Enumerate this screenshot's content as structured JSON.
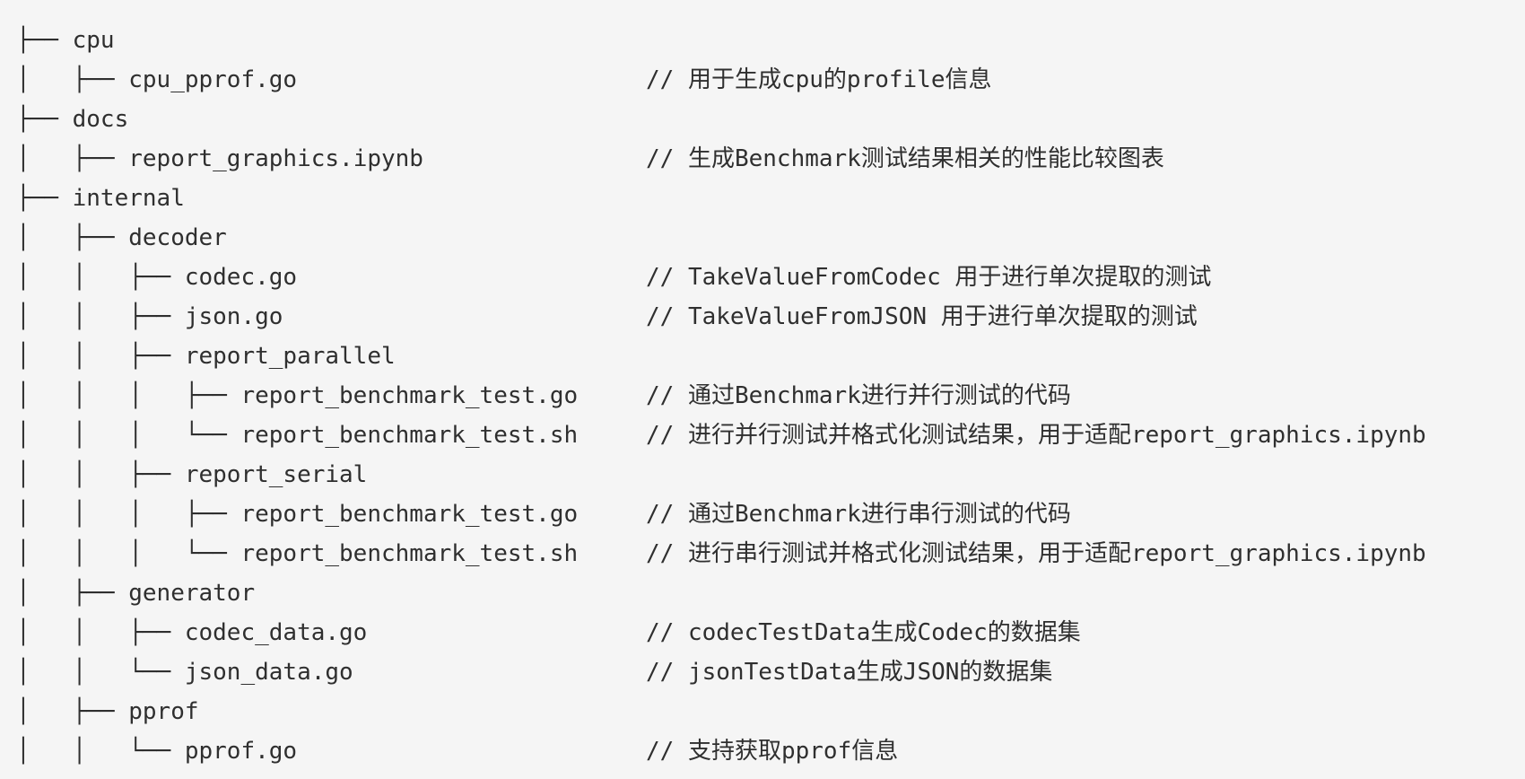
{
  "tree": {
    "lines": [
      {
        "prefix": "├── ",
        "name": "cpu",
        "comment": ""
      },
      {
        "prefix": "│   ├── ",
        "name": "cpu_pprof.go",
        "comment": "// 用于生成cpu的profile信息"
      },
      {
        "prefix": "├── ",
        "name": "docs",
        "comment": ""
      },
      {
        "prefix": "│   ├── ",
        "name": "report_graphics.ipynb",
        "comment": "// 生成Benchmark测试结果相关的性能比较图表"
      },
      {
        "prefix": "├── ",
        "name": "internal",
        "comment": ""
      },
      {
        "prefix": "│   ├── ",
        "name": "decoder",
        "comment": ""
      },
      {
        "prefix": "│   │   ├── ",
        "name": "codec.go",
        "comment": "// TakeValueFromCodec 用于进行单次提取的测试"
      },
      {
        "prefix": "│   │   ├── ",
        "name": "json.go",
        "comment": "// TakeValueFromJSON 用于进行单次提取的测试"
      },
      {
        "prefix": "│   │   ├── ",
        "name": "report_parallel",
        "comment": ""
      },
      {
        "prefix": "│   │   │   ├── ",
        "name": "report_benchmark_test.go",
        "comment": "// 通过Benchmark进行并行测试的代码"
      },
      {
        "prefix": "│   │   │   └── ",
        "name": "report_benchmark_test.sh",
        "comment": "// 进行并行测试并格式化测试结果，用于适配report_graphics.ipynb"
      },
      {
        "prefix": "│   │   ├── ",
        "name": "report_serial",
        "comment": ""
      },
      {
        "prefix": "│   │   │   ├── ",
        "name": "report_benchmark_test.go",
        "comment": "// 通过Benchmark进行串行测试的代码"
      },
      {
        "prefix": "│   │   │   └── ",
        "name": "report_benchmark_test.sh",
        "comment": "// 进行串行测试并格式化测试结果，用于适配report_graphics.ipynb"
      },
      {
        "prefix": "│   ├── ",
        "name": "generator",
        "comment": ""
      },
      {
        "prefix": "│   │   ├── ",
        "name": "codec_data.go",
        "comment": "// codecTestData生成Codec的数据集"
      },
      {
        "prefix": "│   │   └── ",
        "name": "json_data.go",
        "comment": "// jsonTestData生成JSON的数据集"
      },
      {
        "prefix": "│   ├── ",
        "name": "pprof",
        "comment": ""
      },
      {
        "prefix": "│   │   └── ",
        "name": "pprof.go",
        "comment": "// 支持获取pprof信息"
      }
    ]
  }
}
